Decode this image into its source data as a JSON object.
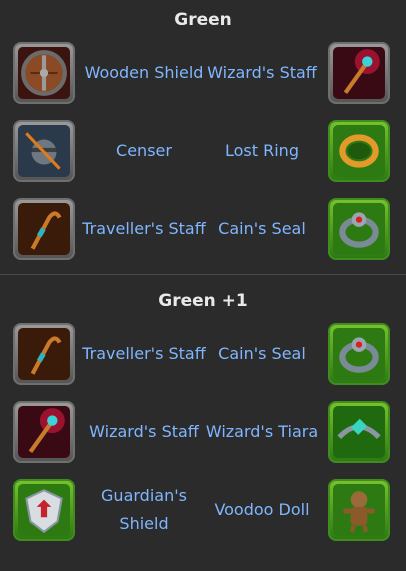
{
  "sections": [
    {
      "title": "Green",
      "rows": [
        {
          "left": {
            "name": "Wooden Shield",
            "icon": "wooden-shield-icon"
          },
          "right": {
            "name": "Wizard's Staff",
            "icon": "wizards-staff-icon"
          }
        },
        {
          "left": {
            "name": "Censer",
            "icon": "censer-icon"
          },
          "right": {
            "name": "Lost Ring",
            "icon": "lost-ring-icon"
          }
        },
        {
          "left": {
            "name": "Traveller's Staff",
            "icon": "travellers-staff-icon"
          },
          "right": {
            "name": "Cain's Seal",
            "icon": "cains-seal-icon"
          }
        }
      ]
    },
    {
      "title": "Green +1",
      "rows": [
        {
          "left": {
            "name": "Traveller's Staff",
            "icon": "travellers-staff-icon"
          },
          "right": {
            "name": "Cain's Seal",
            "icon": "cains-seal-icon"
          }
        },
        {
          "left": {
            "name": "Wizard's Staff",
            "icon": "wizards-staff-icon"
          },
          "right": {
            "name": "Wizard's Tiara",
            "icon": "wizards-tiara-icon"
          }
        },
        {
          "left": {
            "name": "Guardian's Shield",
            "icon": "guardians-shield-icon"
          },
          "right": {
            "name": "Voodoo Doll",
            "icon": "voodoo-doll-icon"
          }
        }
      ]
    }
  ],
  "colors": {
    "background": "#2b2b2b",
    "item_label": "#7fb6ff",
    "title": "#e9e9e9",
    "frame_gray": "#6f6f6f",
    "frame_green": "#3f8d1f"
  }
}
